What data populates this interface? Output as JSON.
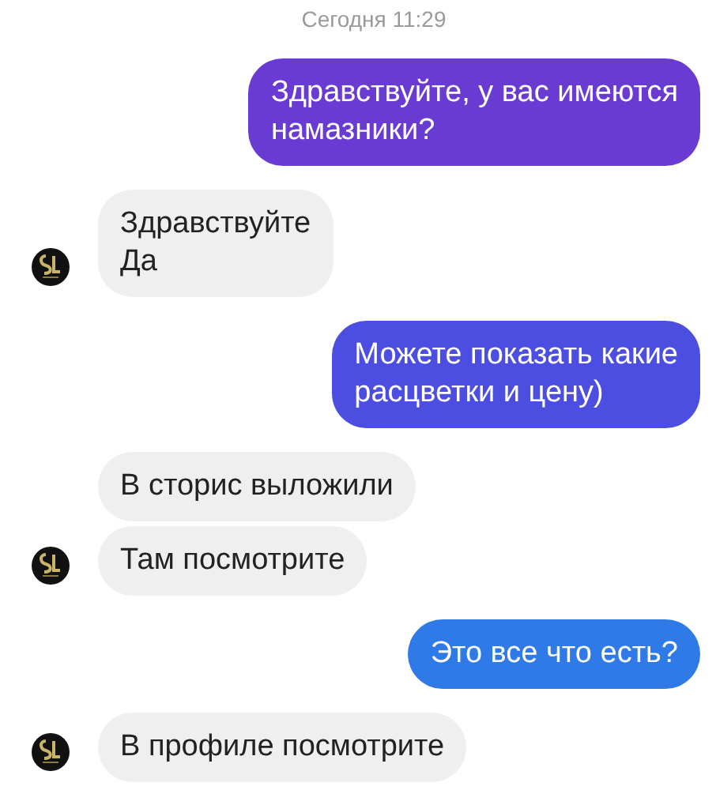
{
  "timestamp": "Сегодня 11:29",
  "groups": [
    {
      "kind": "outgoing",
      "color": "#6a3bd2",
      "messages": [
        "Здравствуйте, у вас имеются\nнамазники?"
      ]
    },
    {
      "kind": "incoming",
      "messages": [
        "Здравствуйте\nДа"
      ]
    },
    {
      "kind": "outgoing",
      "color": "#4b4ee0",
      "messages": [
        "Можете показать какие\nрасцветки и цену)"
      ]
    },
    {
      "kind": "incoming",
      "messages": [
        "В сторис выложили",
        "Там посмотрите"
      ]
    },
    {
      "kind": "outgoing",
      "color": "#2f7ae6",
      "messages": [
        "Это все что есть?"
      ]
    },
    {
      "kind": "incoming",
      "messages": [
        "В профиле посмотрите"
      ]
    }
  ]
}
